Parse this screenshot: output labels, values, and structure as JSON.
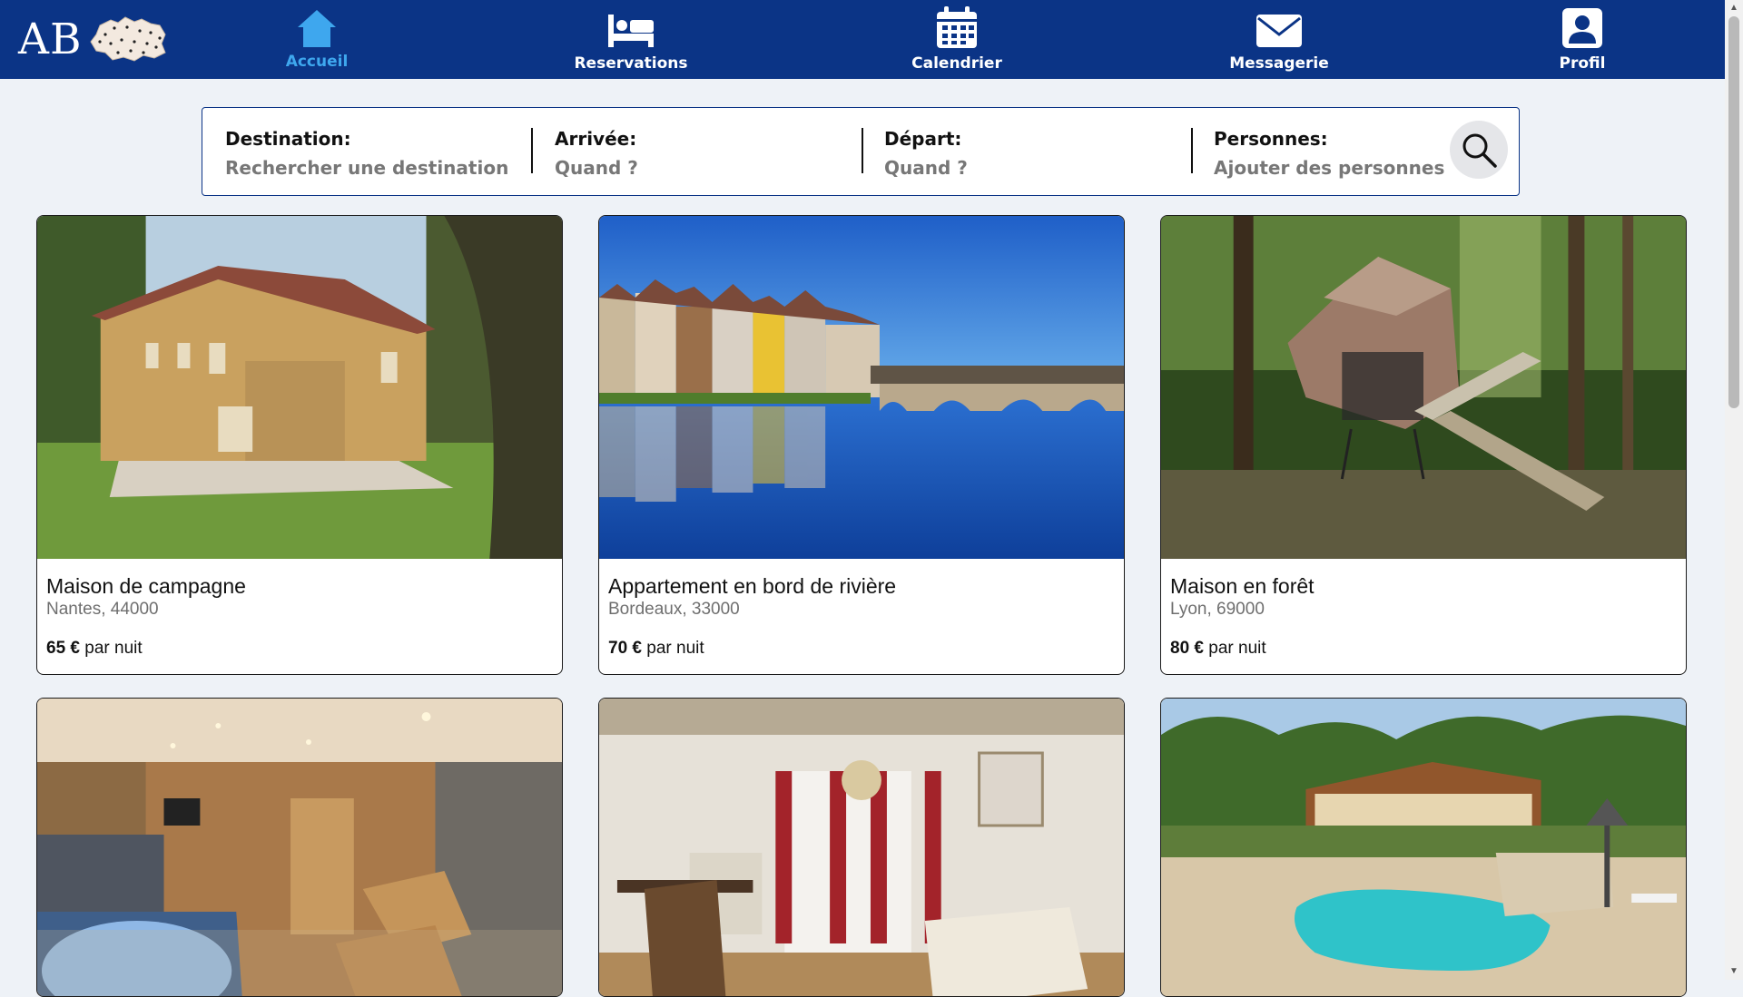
{
  "brand": {
    "logo_text": "AB"
  },
  "nav": {
    "items": [
      {
        "label": "Accueil",
        "icon": "home-icon",
        "active": true
      },
      {
        "label": "Reservations",
        "icon": "bed-icon",
        "active": false
      },
      {
        "label": "Calendrier",
        "icon": "calendar-icon",
        "active": false
      },
      {
        "label": "Messagerie",
        "icon": "mail-icon",
        "active": false
      },
      {
        "label": "Profil",
        "icon": "user-icon",
        "active": false
      }
    ]
  },
  "search": {
    "destination": {
      "label": "Destination:",
      "placeholder": "Rechercher une destination"
    },
    "arrival": {
      "label": "Arrivée:",
      "placeholder": "Quand ?"
    },
    "departure": {
      "label": "Départ:",
      "placeholder": "Quand ?"
    },
    "guests": {
      "label": "Personnes:",
      "placeholder": "Ajouter des personnes"
    },
    "button_icon": "search-icon"
  },
  "listings": [
    {
      "title": "Maison de campagne",
      "location": "Nantes, 44000",
      "price": "65 €",
      "price_unit": "par nuit"
    },
    {
      "title": "Appartement en bord de rivière",
      "location": "Bordeaux, 33000",
      "price": "70 €",
      "price_unit": "par nuit"
    },
    {
      "title": "Maison en forêt",
      "location": "Lyon, 69000",
      "price": "80 €",
      "price_unit": "par nuit"
    },
    {
      "title": "",
      "location": "",
      "price": "",
      "price_unit": ""
    },
    {
      "title": "",
      "location": "",
      "price": "",
      "price_unit": ""
    },
    {
      "title": "",
      "location": "",
      "price": "",
      "price_unit": ""
    }
  ],
  "colors": {
    "nav_background": "#0b3486",
    "active_nav": "#3ea7ee",
    "page_background": "#eef2f7",
    "search_border": "#0b3486"
  }
}
